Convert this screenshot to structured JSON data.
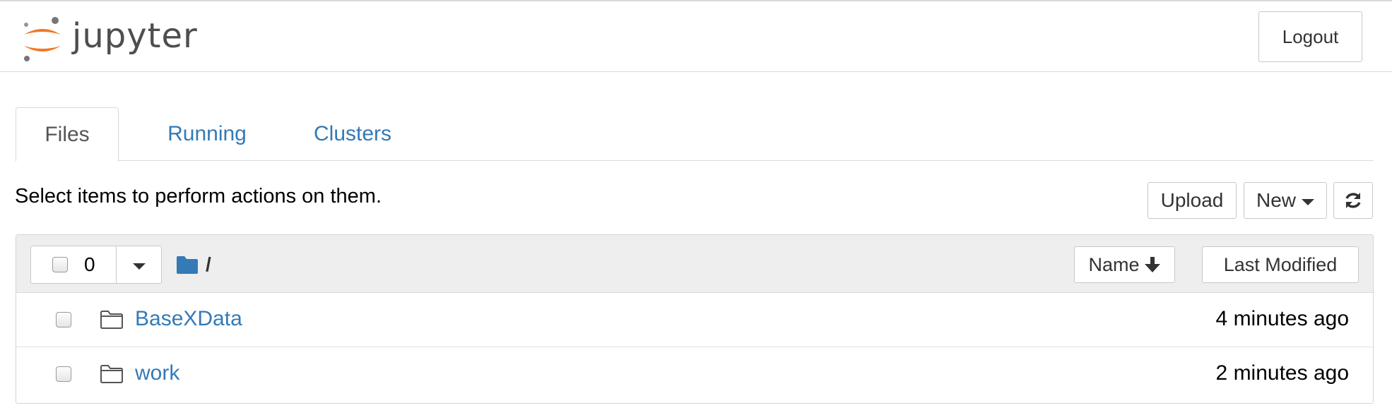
{
  "header": {
    "logo_text": "jupyter",
    "logout_label": "Logout"
  },
  "tabs": [
    {
      "label": "Files",
      "active": true
    },
    {
      "label": "Running",
      "active": false
    },
    {
      "label": "Clusters",
      "active": false
    }
  ],
  "toolbar": {
    "instructions": "Select items to perform actions on them.",
    "upload_label": "Upload",
    "new_label": "New",
    "refresh_icon": "refresh-icon"
  },
  "file_list": {
    "selected_count": "0",
    "breadcrumb_path": "/",
    "sort_name_label": "Name",
    "sort_name_icon": "arrow-down-icon",
    "sort_modified_label": "Last Modified",
    "items": [
      {
        "name": "BaseXData",
        "type": "folder",
        "modified": "4 minutes ago"
      },
      {
        "name": "work",
        "type": "folder",
        "modified": "2 minutes ago"
      }
    ]
  },
  "colors": {
    "link": "#337ab7",
    "logo_orange": "#f37726",
    "logo_gray": "#767677",
    "folder_blue": "#337ab7"
  }
}
